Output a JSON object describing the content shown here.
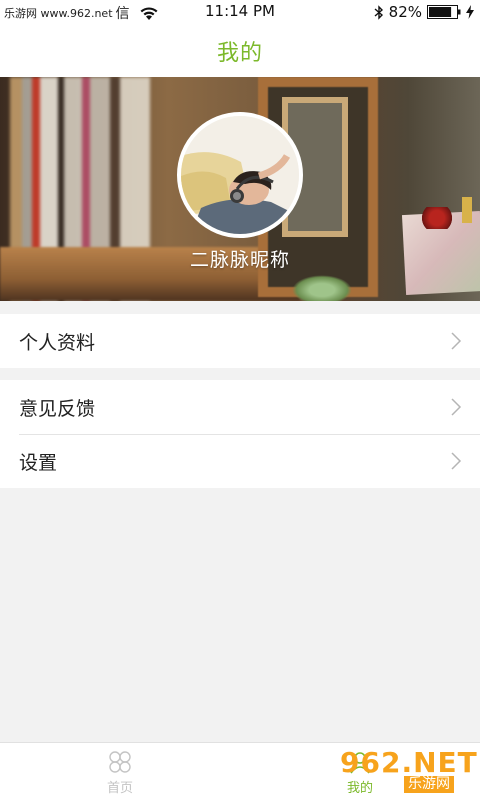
{
  "status_bar": {
    "watermark": "乐游网 www.962.net",
    "carrier": "信",
    "time": "11:14 PM",
    "battery_percent": "82%",
    "battery_level": 0.82,
    "icons": [
      "wifi-icon",
      "bluetooth-icon",
      "battery-icon",
      "charging-icon"
    ]
  },
  "header": {
    "title": "我的",
    "accent_color": "#7cb92b"
  },
  "profile": {
    "nickname": "二脉脉昵称"
  },
  "menu": {
    "group1": [
      {
        "label": "个人资料",
        "icon": "chevron-right-icon"
      }
    ],
    "group2": [
      {
        "label": "意见反馈",
        "icon": "chevron-right-icon"
      },
      {
        "label": "设置",
        "icon": "chevron-right-icon"
      }
    ]
  },
  "tab_bar": {
    "tabs": [
      {
        "label": "首页",
        "icon": "home-clover-icon",
        "active": false
      },
      {
        "label": "我的",
        "icon": "profile-icon",
        "active": true
      }
    ]
  },
  "watermark": {
    "top": "962.NET",
    "bottom": "乐游网"
  }
}
